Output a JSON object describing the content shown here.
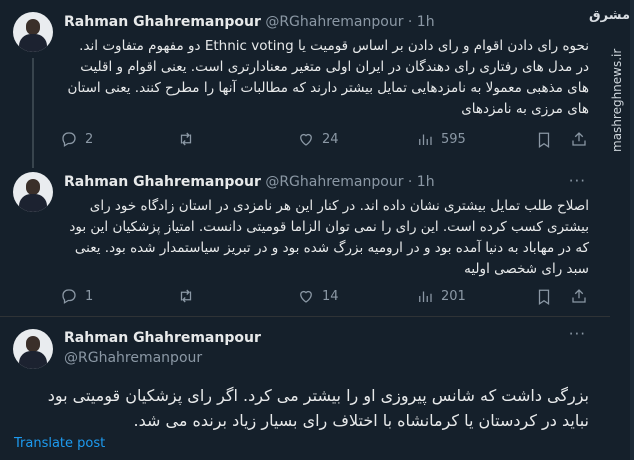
{
  "tweets": [
    {
      "name": "Rahman Ghahremanpour",
      "handle": "@RGhahremanpour",
      "time": "· 1h",
      "text": "نحوه رای دادن اقوام و رای دادن بر اساس قومیت یا Ethnic voting دو مفهوم متفاوت اند. در مدل های رفتاری رای دهندگان در ایران اولی متغیر معنادارتری است. یعنی اقوام و اقلیت های مذهبی معمولا به نامزدهایی تمایل بیشتر دارند که مطالبات آنها را مطرح کنند. یعنی استان های مرزی به نامزدهای",
      "replies": "2",
      "reposts": "",
      "likes": "24",
      "views": "595"
    },
    {
      "name": "Rahman Ghahremanpour",
      "handle": "@RGhahremanpour",
      "time": "· 1h",
      "text": "اصلاح طلب تمایل بیشتری نشان داده اند. در کنار این هر نامزدی در استان زادگاه خود رای بیشتری کسب کرده است. این رای را نمی توان الزاما قومیتی دانست. امتیاز پزشکیان این بود که در مهاباد به دنیا آمده بود و در ارومیه بزرگ شده بود و در تبریز سیاستمدار شده بود. یعنی سبد رای شخصی اولیه",
      "replies": "1",
      "reposts": "",
      "likes": "14",
      "views": "201"
    }
  ],
  "main_tweet": {
    "name": "Rahman Ghahremanpour",
    "handle": "@RGhahremanpour",
    "text": "بزرگی داشت که شانس پیروزی او را بیشتر می کرد. اگر رای پزشکیان قومیتی بود نباید در کردستان یا کرمانشاه با اختلاف رای بسیار زیاد برنده می شد."
  },
  "translate_label": "Translate post",
  "watermark": {
    "logo": "مشرق",
    "url": "mashreghnews.ir"
  },
  "icons": {
    "reply": "reply-icon",
    "repost": "repost-icon",
    "like": "like-icon",
    "views": "views-icon",
    "bookmark": "bookmark-icon",
    "share": "share-icon",
    "more": "more-icon"
  },
  "colors": {
    "background": "#15202b",
    "text": "#e7e9ea",
    "muted": "#8b98a5",
    "link": "#1d9bf0"
  }
}
